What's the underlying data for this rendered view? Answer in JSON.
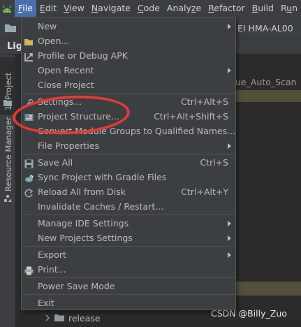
{
  "menubar": {
    "items": [
      {
        "pre": "",
        "mn": "F",
        "post": "ile"
      },
      {
        "pre": "",
        "mn": "E",
        "post": "dit"
      },
      {
        "pre": "",
        "mn": "V",
        "post": "iew"
      },
      {
        "pre": "",
        "mn": "N",
        "post": "avigate"
      },
      {
        "pre": "",
        "mn": "C",
        "post": "ode"
      },
      {
        "pre": "Analy",
        "mn": "z",
        "post": "e"
      },
      {
        "pre": "",
        "mn": "R",
        "post": "efactor"
      },
      {
        "pre": "",
        "mn": "B",
        "post": "uild"
      },
      {
        "pre": "R",
        "mn": "u",
        "post": "n"
      }
    ]
  },
  "toolbar": {
    "device": "EI HMA-AL00"
  },
  "title_strip": {
    "text": "Lig"
  },
  "left_strip": {
    "project_tab": "1: Project",
    "resource_manager": "Resource Manager"
  },
  "background": {
    "scan_label": "ue_Auto_Scan",
    "release_folder": "release",
    "watermark": "CSDN @Billy_Zuo"
  },
  "file_menu": {
    "items": [
      {
        "label": "New",
        "shortcut": "",
        "submenu": true
      },
      {
        "label": "Open...",
        "shortcut": "",
        "submenu": false
      },
      {
        "label": "Profile or Debug APK",
        "shortcut": "",
        "submenu": false
      },
      {
        "label": "Open Recent",
        "shortcut": "",
        "submenu": true
      },
      {
        "label": "Close Project",
        "shortcut": "",
        "submenu": false
      },
      {
        "label": "Settings...",
        "shortcut": "Ctrl+Alt+S",
        "submenu": false
      },
      {
        "label": "Project Structure...",
        "shortcut": "Ctrl+Alt+Shift+S",
        "submenu": false
      },
      {
        "label": "Convert Module Groups to Qualified Names...",
        "shortcut": "",
        "submenu": false
      },
      {
        "label": "File Properties",
        "shortcut": "",
        "submenu": true
      },
      {
        "label": "Save All",
        "shortcut": "Ctrl+S",
        "submenu": false
      },
      {
        "label": "Sync Project with Gradle Files",
        "shortcut": "",
        "submenu": false
      },
      {
        "label": "Reload All from Disk",
        "shortcut": "Ctrl+Alt+Y",
        "submenu": false
      },
      {
        "label": "Invalidate Caches / Restart...",
        "shortcut": "",
        "submenu": false
      },
      {
        "label": "Manage IDE Settings",
        "shortcut": "",
        "submenu": true
      },
      {
        "label": "New Projects Settings",
        "shortcut": "",
        "submenu": true
      },
      {
        "label": "Export",
        "shortcut": "",
        "submenu": true
      },
      {
        "label": "Print...",
        "shortcut": "",
        "submenu": false
      },
      {
        "label": "Power Save Mode",
        "shortcut": "",
        "submenu": false
      },
      {
        "label": "Exit",
        "shortcut": "",
        "submenu": false
      }
    ]
  },
  "colors": {
    "menu_bg": "#3c3f41",
    "selection": "#4b6eaf",
    "annotation_red": "#e53935",
    "android_green": "#78c257"
  }
}
